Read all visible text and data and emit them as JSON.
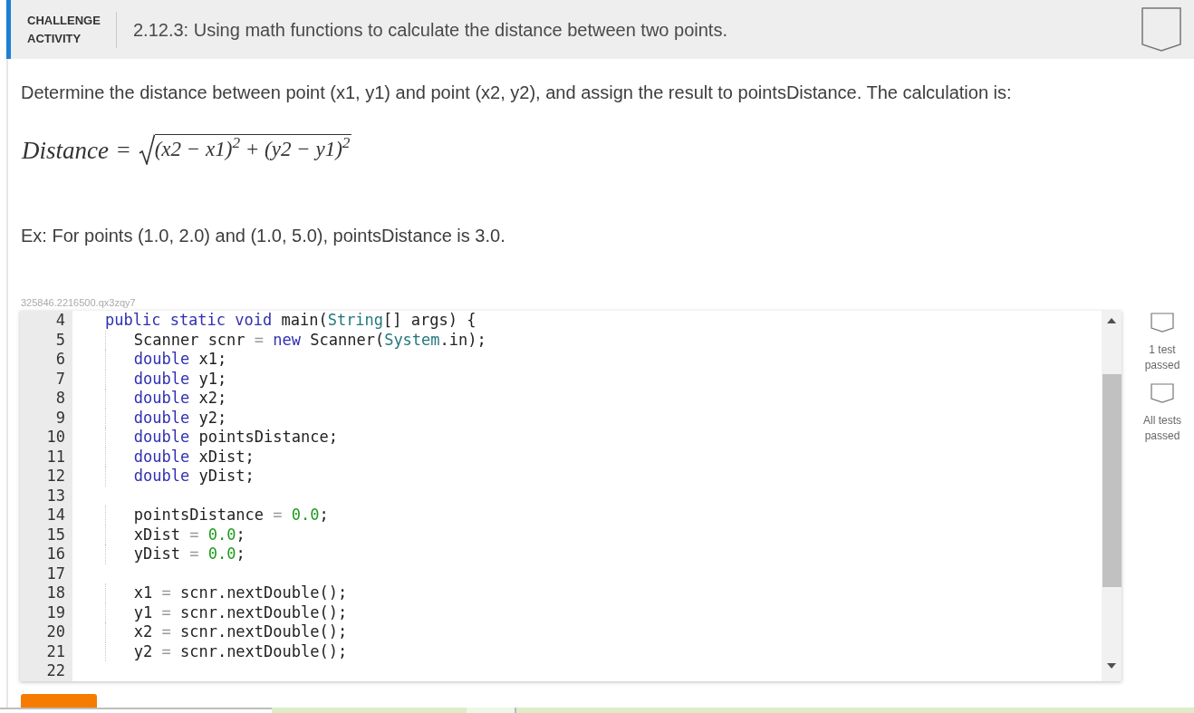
{
  "activity": {
    "type_label": "CHALLENGE ACTIVITY",
    "title": "2.12.3: Using math functions to calculate the distance between two points.",
    "completed": false
  },
  "instructions": "Determine the distance between point (x1, y1) and point (x2, y2), and assign the result to pointsDistance. The calculation is:",
  "formula": {
    "lhs": "Distance",
    "relation": "=",
    "radicand": "(x2 − x1)$^{2}$ + (y2 − y1)$^{2}$"
  },
  "example": "Ex: For points (1.0, 2.0) and (1.0, 5.0), pointsDistance is 3.0.",
  "code_id": "325846.2216500.qx3zqy7",
  "editor": {
    "lines": [
      {
        "number": "4",
        "tokens": [
          {
            "kind": "keyword",
            "text": "public static void"
          },
          {
            "kind": "plain",
            "text": " main("
          },
          {
            "kind": "type",
            "text": "String"
          },
          {
            "kind": "plain",
            "text": "[] args) {"
          }
        ],
        "children": [
          {
            "number": "5",
            "tokens": [
              {
                "kind": "plain",
                "text": "Scanner scnr "
              },
              {
                "kind": "operator",
                "text": "= "
              },
              {
                "kind": "keyword",
                "text": "new"
              },
              {
                "kind": "plain",
                "text": " Scanner("
              },
              {
                "kind": "type",
                "text": "System"
              },
              {
                "kind": "plain",
                "text": ".in);"
              }
            ]
          },
          {
            "number": "6",
            "tokens": [
              {
                "kind": "keyword",
                "text": "double"
              },
              {
                "kind": "plain",
                "text": " x1;"
              }
            ]
          },
          {
            "number": "7",
            "tokens": [
              {
                "kind": "keyword",
                "text": "double"
              },
              {
                "kind": "plain",
                "text": " y1;"
              }
            ]
          },
          {
            "number": "8",
            "tokens": [
              {
                "kind": "keyword",
                "text": "double"
              },
              {
                "kind": "plain",
                "text": " x2;"
              }
            ]
          },
          {
            "number": "9",
            "tokens": [
              {
                "kind": "keyword",
                "text": "double"
              },
              {
                "kind": "plain",
                "text": " y2;"
              }
            ]
          },
          {
            "number": "10",
            "tokens": [
              {
                "kind": "keyword",
                "text": "double"
              },
              {
                "kind": "plain",
                "text": " pointsDistance;"
              }
            ]
          },
          {
            "number": "11",
            "tokens": [
              {
                "kind": "keyword",
                "text": "double"
              },
              {
                "kind": "plain",
                "text": " xDist;"
              }
            ]
          },
          {
            "number": "12",
            "tokens": [
              {
                "kind": "keyword",
                "text": "double"
              },
              {
                "kind": "plain",
                "text": " yDist;"
              }
            ]
          },
          {
            "number": "13"
          },
          {
            "number": "14",
            "tokens": [
              {
                "kind": "plain",
                "text": "pointsDistance "
              },
              {
                "kind": "operator",
                "text": "= "
              },
              {
                "kind": "number",
                "text": "0.0"
              },
              {
                "kind": "plain",
                "text": ";"
              }
            ]
          },
          {
            "number": "15",
            "tokens": [
              {
                "kind": "plain",
                "text": "xDist "
              },
              {
                "kind": "operator",
                "text": "= "
              },
              {
                "kind": "number",
                "text": "0.0"
              },
              {
                "kind": "plain",
                "text": ";"
              }
            ]
          },
          {
            "number": "16",
            "tokens": [
              {
                "kind": "plain",
                "text": "yDist "
              },
              {
                "kind": "operator",
                "text": "= "
              },
              {
                "kind": "number",
                "text": "0.0"
              },
              {
                "kind": "plain",
                "text": ";"
              }
            ]
          },
          {
            "number": "17"
          },
          {
            "number": "18",
            "tokens": [
              {
                "kind": "plain",
                "text": "x1 "
              },
              {
                "kind": "operator",
                "text": "= "
              },
              {
                "kind": "plain",
                "text": "scnr.nextDouble();"
              }
            ]
          },
          {
            "number": "19",
            "tokens": [
              {
                "kind": "plain",
                "text": "y1 "
              },
              {
                "kind": "operator",
                "text": "= "
              },
              {
                "kind": "plain",
                "text": "scnr.nextDouble();"
              }
            ]
          },
          {
            "number": "20",
            "tokens": [
              {
                "kind": "plain",
                "text": "x2 "
              },
              {
                "kind": "operator",
                "text": "= "
              },
              {
                "kind": "plain",
                "text": "scnr.nextDouble();"
              }
            ]
          },
          {
            "number": "21",
            "tokens": [
              {
                "kind": "plain",
                "text": "y2 "
              },
              {
                "kind": "operator",
                "text": "= "
              },
              {
                "kind": "plain",
                "text": "scnr.nextDouble();"
              }
            ]
          }
        ]
      },
      {
        "number": "22"
      }
    ]
  },
  "tests": [
    {
      "label": "1 test passed",
      "achieved": false
    },
    {
      "label": "All tests passed",
      "achieved": false
    }
  ]
}
